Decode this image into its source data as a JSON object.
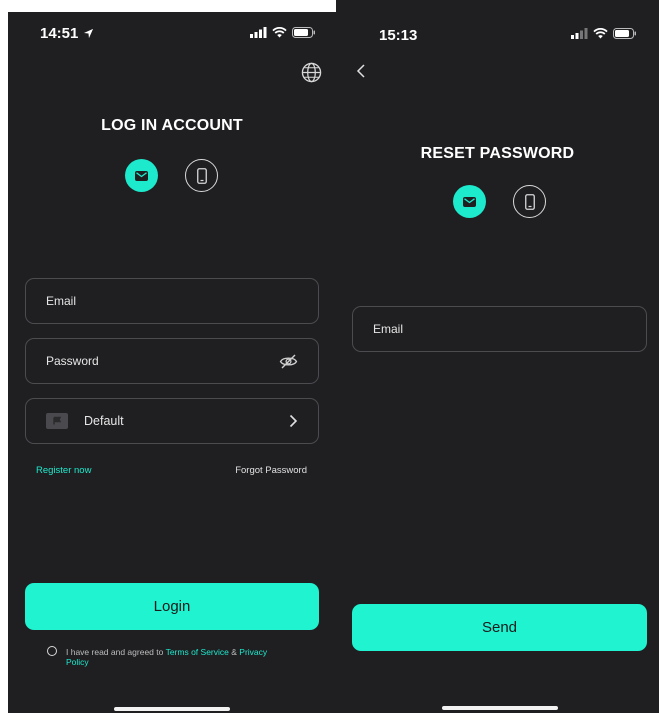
{
  "colors": {
    "background": "#1f1f22",
    "accent": "#1de9cc",
    "button": "#1ff3d0",
    "field_border": "#4b4b50"
  },
  "login_screen": {
    "status_time": "14:51",
    "title": "LOG IN ACCOUNT",
    "email_placeholder": "Email",
    "password_placeholder": "Password",
    "region_value": "Default",
    "register_label": "Register now",
    "forgot_label": "Forgot Password",
    "login_label": "Login",
    "agree_prefix": "I have read and agreed to",
    "terms_label": "Terms of Service",
    "ampersand": "&",
    "privacy_label": "Privacy",
    "policy_label": "Policy"
  },
  "reset_screen": {
    "status_time": "15:13",
    "title": "RESET PASSWORD",
    "email_placeholder": "Email",
    "send_label": "Send"
  }
}
